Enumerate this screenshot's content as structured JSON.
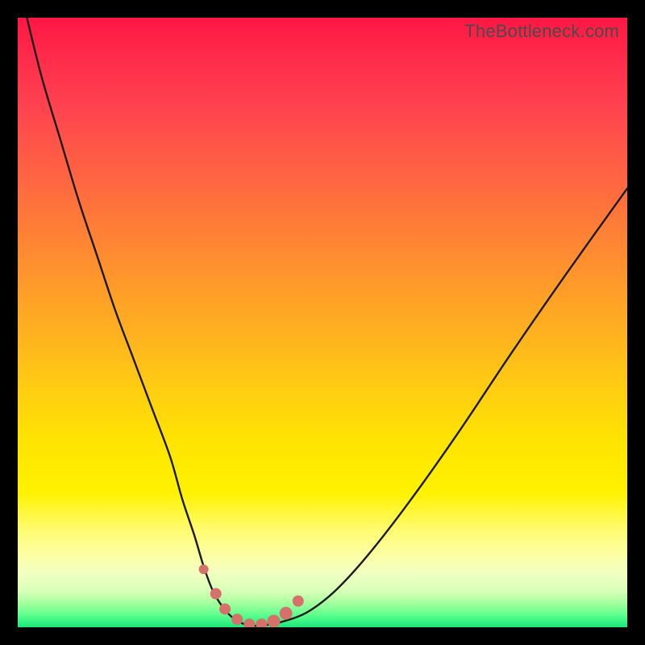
{
  "watermark": "TheBottleneck.com",
  "colors": {
    "frame": "#000000",
    "curve_stroke": "#1a1a1a",
    "marker_fill": "#d6706b",
    "marker_stroke": "#d6706b"
  },
  "chart_data": {
    "type": "line",
    "title": "",
    "xlabel": "",
    "ylabel": "",
    "xlim": [
      0,
      100
    ],
    "ylim": [
      0,
      100
    ],
    "grid": false,
    "legend": false,
    "note": "The curve is a bottleneck V-shape. No axis ticks or numeric labels are shown in the image; x/y values below are estimated from pixel positions on a 0–100 normalized scale (x left→right, y bottom→top).",
    "series": [
      {
        "name": "bottleneck-curve",
        "x": [
          1.5,
          4,
          7,
          10,
          13,
          16,
          19,
          22,
          25,
          27,
          29,
          30.5,
          32,
          33.5,
          35,
          36.5,
          38,
          40,
          43,
          47,
          51,
          55,
          60,
          66,
          73,
          81,
          90,
          100
        ],
        "y": [
          100,
          90,
          80,
          70,
          61,
          52,
          44,
          36,
          28,
          21,
          15,
          10,
          6,
          3.5,
          1.8,
          0.8,
          0.3,
          0.3,
          0.8,
          2.2,
          5,
          9,
          15,
          23,
          33,
          45,
          58,
          72
        ]
      }
    ],
    "markers": {
      "name": "highlight-dots",
      "x": [
        30.5,
        32.5,
        34,
        36,
        38,
        40,
        42,
        44,
        46
      ],
      "y": [
        9.5,
        5.5,
        3.0,
        1.3,
        0.5,
        0.5,
        1.0,
        2.3,
        4.3
      ],
      "r": [
        6,
        7,
        7,
        7,
        7,
        7,
        8,
        8,
        7
      ]
    }
  }
}
